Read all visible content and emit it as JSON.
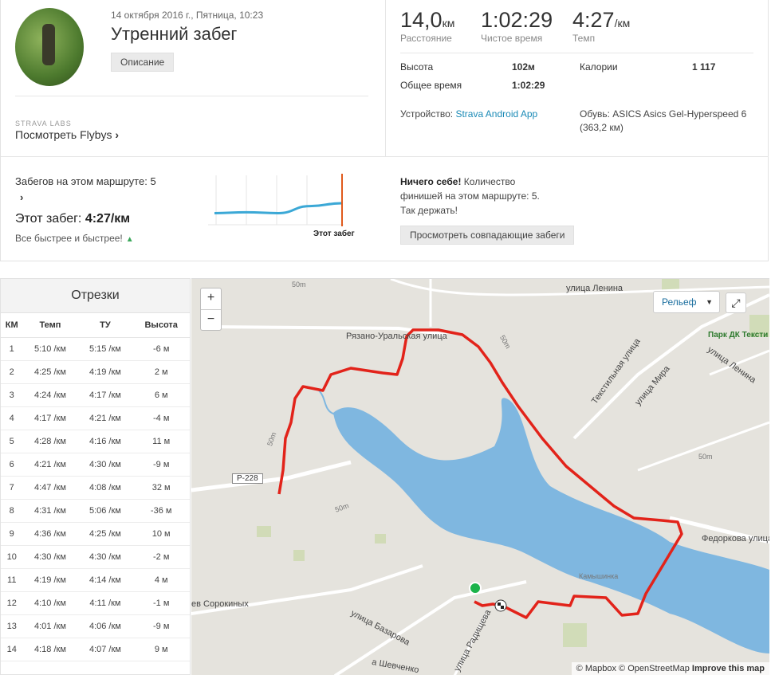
{
  "activity": {
    "date": "14 октября 2016 г., Пятница, 10:23",
    "title": "Утренний забег",
    "description_button": "Описание"
  },
  "flyby": {
    "labs": "STRAVA LABS",
    "link": "Посмотреть Flybys",
    "chevron": "›"
  },
  "stats": {
    "distance_value": "14,0",
    "distance_unit": "км",
    "distance_label": "Расстояние",
    "moving_time_value": "1:02:29",
    "moving_time_label": "Чистое время",
    "pace_value": "4:27",
    "pace_unit": "/км",
    "pace_label": "Темп",
    "elevation_label": "Высота",
    "elevation_value": "102м",
    "elapsed_label": "Общее время",
    "elapsed_value": "1:02:29",
    "calories_label": "Калории",
    "calories_value": "1 117",
    "device_label": "Устройство: ",
    "device_value": "Strava Android App",
    "shoes_label": "Обувь: ASICS Asics Gel-Hyperspeed 6",
    "shoes_distance": "(363,2 км)"
  },
  "route": {
    "runs_text": "Забегов на этом маршруте: 5",
    "chevron": "›",
    "this_run_label": "Этот забег: ",
    "this_run_value": "4:27/км",
    "trend": "Все быстрее и быстрее!",
    "trend_icon": "up-triangle-icon",
    "chart_label": "Этот забег",
    "chart_line_color": "#3ba8d6",
    "chart_marker_color": "#e05a1c",
    "pace_trend_points": [
      0.28,
      0.3,
      0.28,
      0.45,
      0.52
    ]
  },
  "kudos": {
    "bold": "Ничего себе!",
    "text": " Количество финишей на этом маршруте: 5. Так держать!",
    "button": "Просмотреть совпадающие забеги"
  },
  "splits": {
    "title": "Отрезки",
    "headers": [
      "КМ",
      "Темп",
      "ТУ",
      "Высота"
    ],
    "rows": [
      [
        "1",
        "5:10 /км",
        "5:15 /км",
        "-6 м"
      ],
      [
        "2",
        "4:25 /км",
        "4:19 /км",
        "2 м"
      ],
      [
        "3",
        "4:24 /км",
        "4:17 /км",
        "6 м"
      ],
      [
        "4",
        "4:17 /км",
        "4:21 /км",
        "-4 м"
      ],
      [
        "5",
        "4:28 /км",
        "4:16 /км",
        "11 м"
      ],
      [
        "6",
        "4:21 /км",
        "4:30 /км",
        "-9 м"
      ],
      [
        "7",
        "4:47 /км",
        "4:08 /км",
        "32 м"
      ],
      [
        "8",
        "4:31 /км",
        "5:06 /км",
        "-36 м"
      ],
      [
        "9",
        "4:36 /км",
        "4:25 /км",
        "10 м"
      ],
      [
        "10",
        "4:30 /км",
        "4:30 /км",
        "-2 м"
      ],
      [
        "11",
        "4:19 /км",
        "4:14 /км",
        "4 м"
      ],
      [
        "12",
        "4:10 /км",
        "4:11 /км",
        "-1 м"
      ],
      [
        "13",
        "4:01 /км",
        "4:06 /км",
        "-9 м"
      ],
      [
        "14",
        "4:18 /км",
        "4:07 /км",
        "9 м"
      ]
    ]
  },
  "map": {
    "zoom_in": "+",
    "zoom_out": "−",
    "layer": "Рельеф",
    "fullscreen_icon": "fullscreen-icon",
    "attrib_mapbox": "© Mapbox",
    "attrib_osm": "© OpenStreetMap",
    "attrib_improve": "Improve this map",
    "route_color": "#e2231a",
    "water_color": "#7fb7e0",
    "labels": {
      "lenina": "улица Ленина",
      "ryazano": "Рязано-Уральская улица",
      "park": "Парк ДК Тексти",
      "lenina2": "улица Ленина",
      "textile": "Текстильная улица",
      "mira": "улица Мира",
      "fedorkova": "Федоркова улица",
      "kamyshinka": "Камышинка",
      "sorokinykh": "ев Сорокиных",
      "bazarova": "улица Базарова",
      "radishcheva": "улица Радищева",
      "shevchenko": "а Шевченко",
      "r228": "Р-228",
      "c50a": "50m",
      "c50b": "50m",
      "c50c": "50m",
      "c50d": "50m",
      "c50e": "50m"
    }
  }
}
